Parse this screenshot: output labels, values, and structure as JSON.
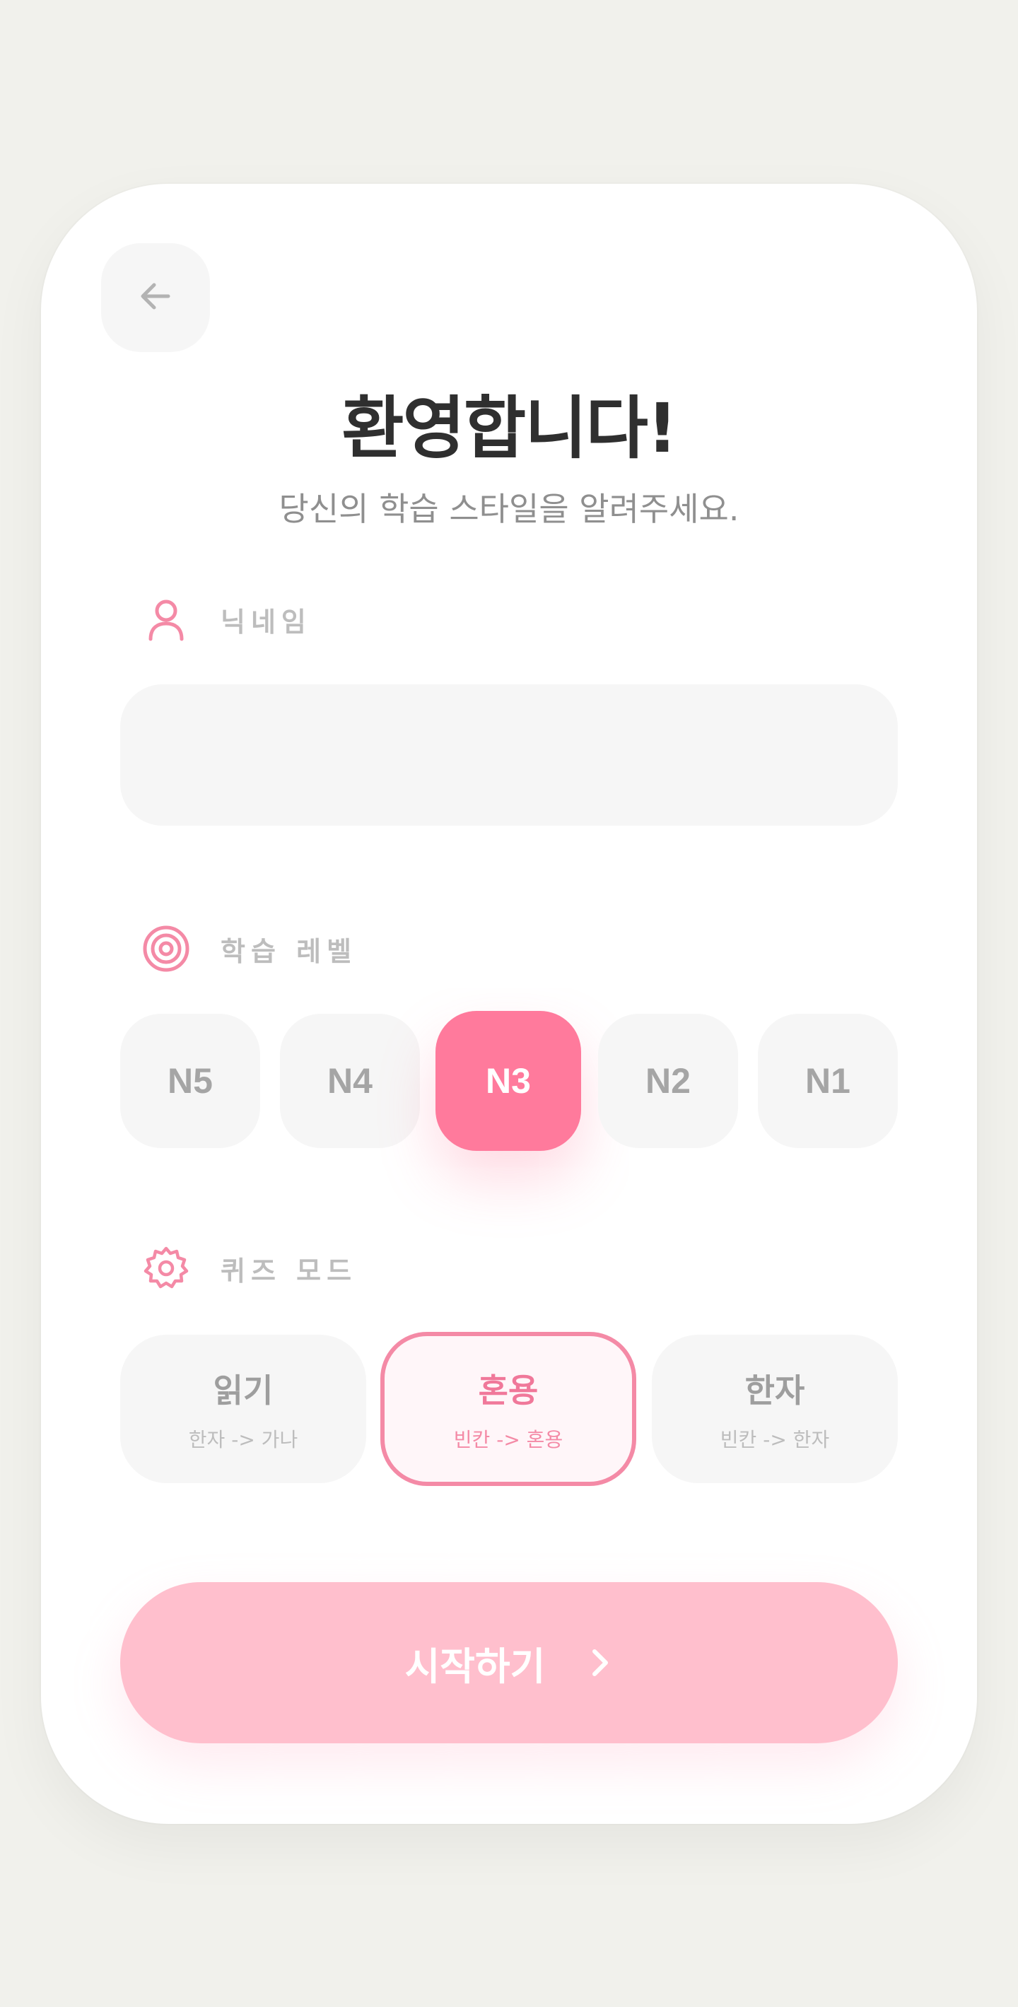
{
  "header": {
    "back_icon": "arrow-left-icon",
    "title": "환영합니다!",
    "subtitle": "당신의 학습 스타일을 알려주세요."
  },
  "nickname": {
    "icon": "user-icon",
    "label": "닉네임",
    "value": "",
    "placeholder": ""
  },
  "level": {
    "icon": "target-icon",
    "label": "학습 레벨",
    "options": [
      "N5",
      "N4",
      "N3",
      "N2",
      "N1"
    ],
    "selected": "N3"
  },
  "quiz_mode": {
    "icon": "gear-icon",
    "label": "퀴즈 모드",
    "options": [
      {
        "title": "읽기",
        "sub": "한자 -> 가나"
      },
      {
        "title": "혼용",
        "sub": "빈칸 -> 혼용"
      },
      {
        "title": "한자",
        "sub": "빈칸 -> 한자"
      }
    ],
    "selected": "혼용"
  },
  "start_button": {
    "label": "시작하기",
    "icon": "chevron-right-icon"
  },
  "colors": {
    "accent": "#ff7a9c",
    "accent_light": "#ffbfcd",
    "muted": "#f6f6f6",
    "title": "#2f2f2f"
  }
}
